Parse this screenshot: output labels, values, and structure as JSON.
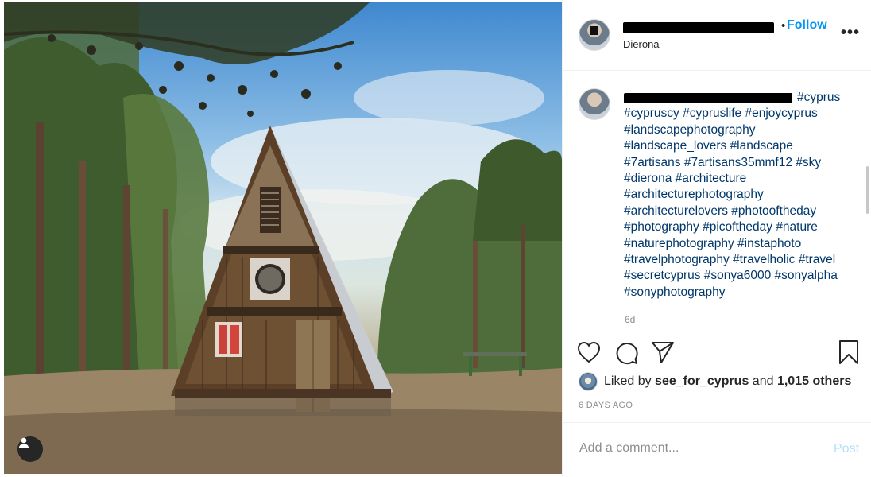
{
  "post": {
    "location": "Dierona",
    "follow_separator": "•",
    "follow_label": "Follow",
    "more_icon": "more-horizontal-icon",
    "caption_first_hashtag": "#cyprus",
    "caption_hashtags": "#cypruscy #cypruslife #enjoycyprus #landscapephotography #landscape_lovers #landscape #7artisans #7artisans35mmf12 #sky #dierona #architecture #architecturephotography #architecturelovers #photooftheday #photography #picoftheday #nature #naturephotography #instaphoto #travelphotography #travelholic #travel #secretcyprus #sonya6000 #sonyalpha #sonyphotography",
    "caption_time": "6d"
  },
  "actions": {
    "like_icon": "heart-icon",
    "comment_icon": "comment-icon",
    "share_icon": "share-icon",
    "save_icon": "bookmark-icon"
  },
  "likes": {
    "prefix": "Liked by",
    "user": "see_for_cyprus",
    "middle": "and",
    "others": "1,015 others"
  },
  "timestamp": "6 DAYS AGO",
  "comment": {
    "placeholder": "Add a comment...",
    "post_label": "Post"
  },
  "colors": {
    "link": "#00376b",
    "accent": "#0095f6",
    "post_disabled": "#b2dffc",
    "muted": "#8e8e8e"
  }
}
